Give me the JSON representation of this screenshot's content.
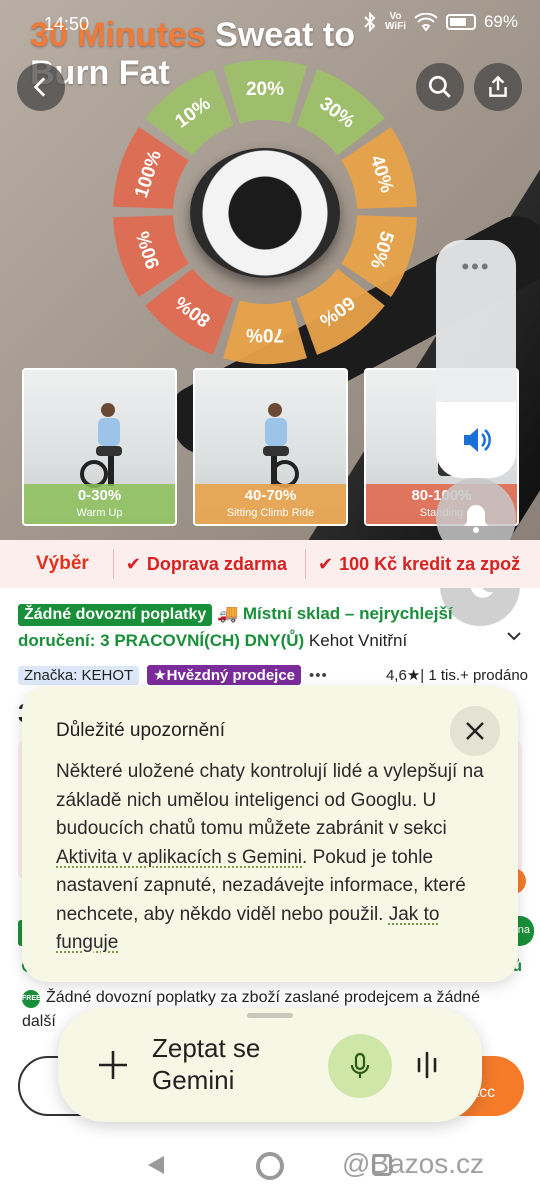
{
  "status_bar": {
    "time": "14:50",
    "network": "Vo\nWiFi",
    "battery": "69%"
  },
  "hero": {
    "title_accent": "30 Minutes",
    "title_rest": " Sweat to",
    "title_line2": "Burn Fat",
    "dial_levels": [
      "10%",
      "20%",
      "30%",
      "40%",
      "50%",
      "60%",
      "70%",
      "80%",
      "90%",
      "100%"
    ],
    "dial_colors": {
      "green": "#9dc06a",
      "orange": "#e9a24a",
      "red": "#df6b52"
    },
    "thumbnails": [
      {
        "big": "0-30%",
        "small": "Warm Up",
        "color": "#8cc05a"
      },
      {
        "big": "40-70%",
        "small": "Sitting Climb Ride",
        "color": "#e9a24a"
      },
      {
        "big": "80-100%",
        "small": "Standing",
        "color": "#e06a50"
      }
    ]
  },
  "overlay": {
    "volume_level": 0.32,
    "menu_dots": "•••"
  },
  "promo": {
    "brand": "Výběr",
    "items": [
      "Doprava zdarma",
      "100 Kč kredit za zpož"
    ]
  },
  "product": {
    "tag_no_import_fees": "Žádné dovozní poplatky",
    "local_warehouse": "Místní sklad – nejrychlejší",
    "delivery": "doručení: 3 PRACOVNÍ(CH) DNY(Ů)",
    "seller_note": "Kehot Vnitřní",
    "brand_badge": "Značka: KEHOT",
    "star_seller": "Hvězdný prodejce",
    "more": "•••",
    "rating": "4,6",
    "sold": "| 1 tis.+ prodáno",
    "price_partial": "3",
    "no_fees_line": "Žádné dovozní poplatky za zboží zaslané prodejcem a žádné",
    "no_fees_line2": "další",
    "buy_button_partial": "pracc",
    "right_green_pill": "na",
    "right_green_text": "ů",
    "accent_color": "#1a8f3a"
  },
  "notice": {
    "title": "Důležité upozornění",
    "body_1": "Některé uložené chaty kontrolují lidé a vylepšují na základě nich umělou inteligenci od Googlu. U budoucích chatů tomu můžete zabránit v sekci ",
    "link_1": "Aktivita v aplikacích s Gemini",
    "body_2": ". Pokud je tohle nastavení zapnuté, nezadávejte informace, které nechcete, aby někdo viděl nebo použil. ",
    "link_2": "Jak to funguje"
  },
  "gemini": {
    "placeholder": "Zeptat se Gemini"
  },
  "watermark": "@Bazos.cz"
}
